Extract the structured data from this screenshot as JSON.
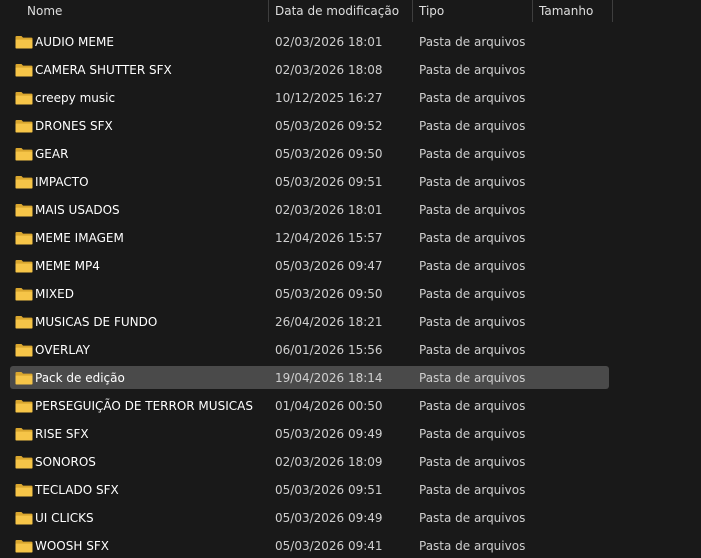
{
  "columns": {
    "name": "Nome",
    "date": "Data de modificação",
    "type": "Tipo",
    "size": "Tamanho"
  },
  "colors": {
    "background": "#191919",
    "selected_row": "#4a4a4a",
    "folder": "#f6c548"
  },
  "selected_index": 12,
  "items": [
    {
      "name": "AUDIO MEME",
      "date": "02/03/2026 18:01",
      "type": "Pasta de arquivos",
      "size": ""
    },
    {
      "name": "CAMERA SHUTTER SFX",
      "date": "02/03/2026 18:08",
      "type": "Pasta de arquivos",
      "size": ""
    },
    {
      "name": "creepy music",
      "date": "10/12/2025 16:27",
      "type": "Pasta de arquivos",
      "size": ""
    },
    {
      "name": "DRONES SFX",
      "date": "05/03/2026 09:52",
      "type": "Pasta de arquivos",
      "size": ""
    },
    {
      "name": "GEAR",
      "date": "05/03/2026 09:50",
      "type": "Pasta de arquivos",
      "size": ""
    },
    {
      "name": "IMPACTO",
      "date": "05/03/2026 09:51",
      "type": "Pasta de arquivos",
      "size": ""
    },
    {
      "name": "MAIS USADOS",
      "date": "02/03/2026 18:01",
      "type": "Pasta de arquivos",
      "size": ""
    },
    {
      "name": "MEME IMAGEM",
      "date": "12/04/2026 15:57",
      "type": "Pasta de arquivos",
      "size": ""
    },
    {
      "name": "MEME MP4",
      "date": "05/03/2026 09:47",
      "type": "Pasta de arquivos",
      "size": ""
    },
    {
      "name": "MIXED",
      "date": "05/03/2026 09:50",
      "type": "Pasta de arquivos",
      "size": ""
    },
    {
      "name": "MUSICAS DE FUNDO",
      "date": "26/04/2026 18:21",
      "type": "Pasta de arquivos",
      "size": ""
    },
    {
      "name": "OVERLAY",
      "date": "06/01/2026 15:56",
      "type": "Pasta de arquivos",
      "size": ""
    },
    {
      "name": "Pack de edição",
      "date": "19/04/2026 18:14",
      "type": "Pasta de arquivos",
      "size": ""
    },
    {
      "name": "PERSEGUIÇÃO DE TERROR MUSICAS",
      "date": "01/04/2026 00:50",
      "type": "Pasta de arquivos",
      "size": ""
    },
    {
      "name": "RISE SFX",
      "date": "05/03/2026 09:49",
      "type": "Pasta de arquivos",
      "size": ""
    },
    {
      "name": "SONOROS",
      "date": "02/03/2026 18:09",
      "type": "Pasta de arquivos",
      "size": ""
    },
    {
      "name": "TECLADO SFX",
      "date": "05/03/2026 09:51",
      "type": "Pasta de arquivos",
      "size": ""
    },
    {
      "name": "UI CLICKS",
      "date": "05/03/2026 09:49",
      "type": "Pasta de arquivos",
      "size": ""
    },
    {
      "name": "WOOSH SFX",
      "date": "05/03/2026 09:41",
      "type": "Pasta de arquivos",
      "size": ""
    }
  ]
}
